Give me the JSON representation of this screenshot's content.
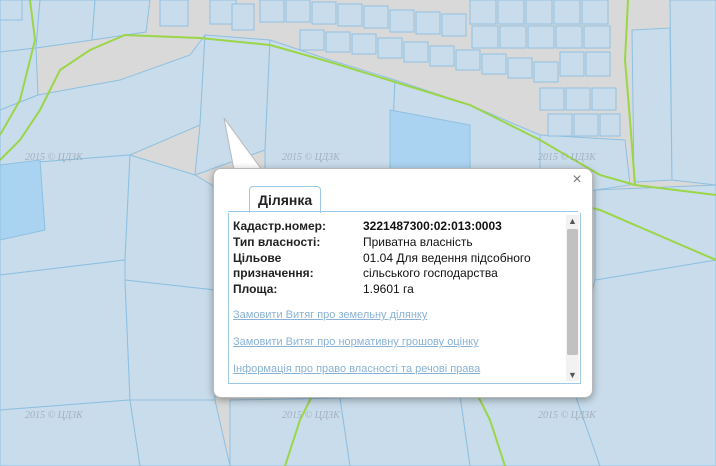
{
  "map": {
    "watermark": "2015 © ЦДЗК",
    "colors": {
      "background": "#d9d9d9",
      "parcel_fill": "#c9dceb",
      "parcel_stroke": "#8ec0e0",
      "selected_fill": "#aad3f1",
      "boundary": "#9bd548"
    }
  },
  "popup": {
    "close_symbol": "×",
    "tab_label": "Ділянка",
    "fields": [
      {
        "label": "Кадастр.номер:",
        "value": "3221487300:02:013:0003"
      },
      {
        "label": "Тип власності:",
        "value": "Приватна власність"
      },
      {
        "label": "Цільове призначення:",
        "value": "01.04 Для ведення підсобного сільського господарства"
      },
      {
        "label": "Площа:",
        "value": "1.9601 га"
      }
    ],
    "links": [
      "Замовити Витяг про земельну ділянку",
      "Замовити Витяг про нормативну грошову оцінку",
      "Інформація про право власності та речові права"
    ]
  }
}
